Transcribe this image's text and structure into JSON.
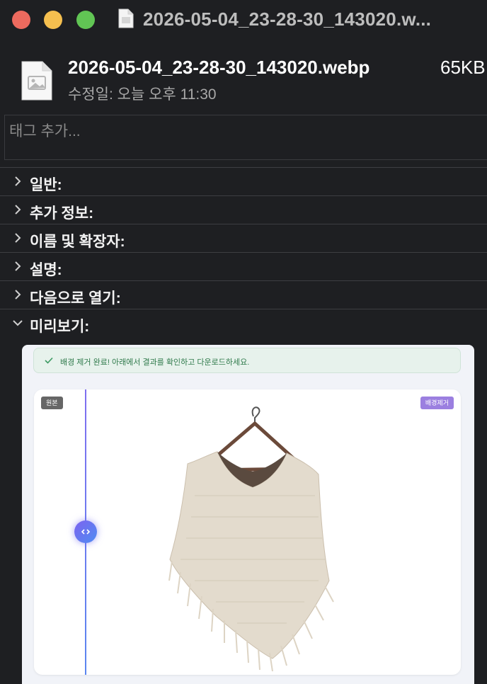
{
  "window": {
    "title": "2026-05-04_23-28-30_143020.w...",
    "controls": [
      "close",
      "minimize",
      "maximize"
    ]
  },
  "header": {
    "file_name": "2026-05-04_23-28-30_143020.webp",
    "file_size": "65KB",
    "modified": "수정일: 오늘 오후 11:30"
  },
  "tags": {
    "placeholder": "태그 추가..."
  },
  "sections": [
    {
      "label": "일반:",
      "expanded": false
    },
    {
      "label": "추가 정보:",
      "expanded": false
    },
    {
      "label": "이름 및 확장자:",
      "expanded": false
    },
    {
      "label": "설명:",
      "expanded": false
    },
    {
      "label": "다음으로 열기:",
      "expanded": false
    },
    {
      "label": "미리보기:",
      "expanded": true
    }
  ],
  "preview": {
    "notice": "배경 제거 완료! 아래에서 결과를 확인하고 다운로드하세요.",
    "badge_original": "원본",
    "badge_removed": "배경제거"
  },
  "colors": {
    "background": "#1e1f22",
    "notice_text": "#2f7a4b",
    "accent_purple": "#9b7fe0"
  }
}
